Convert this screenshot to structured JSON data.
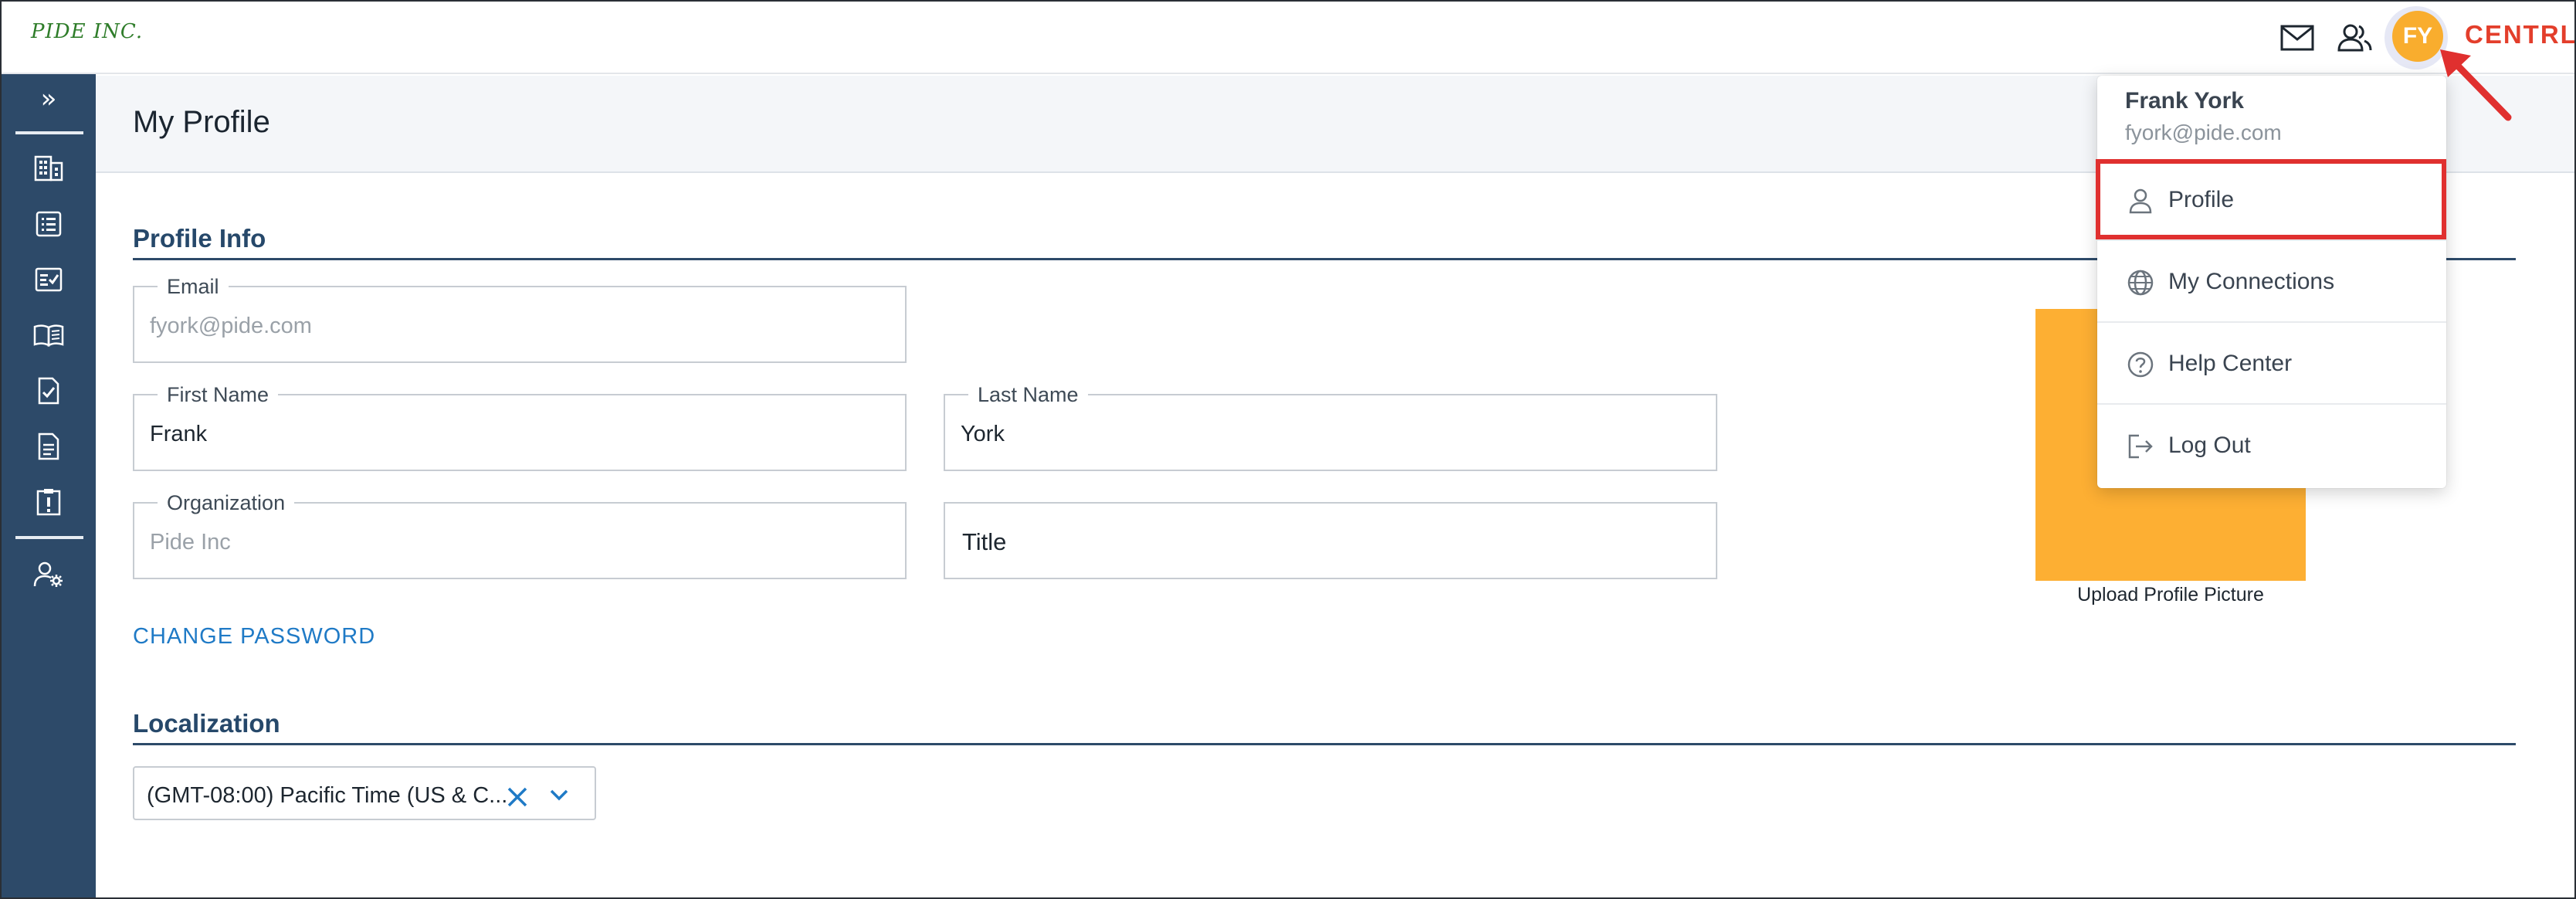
{
  "topbar": {
    "brand": "PIDE INC.",
    "avatar_initials": "FY",
    "product_name": "CENTRL",
    "colors": {
      "avatar": "#f9ad2e",
      "product": "#e33e2b"
    }
  },
  "sidebar": {
    "expand_glyph": "»",
    "items": [
      {
        "icon": "building-icon"
      },
      {
        "icon": "list-icon"
      },
      {
        "icon": "checklist-icon"
      },
      {
        "icon": "book-icon"
      },
      {
        "icon": "file-check-icon"
      },
      {
        "icon": "document-icon"
      },
      {
        "icon": "clipboard-alert-icon"
      },
      {
        "icon": "user-settings-icon"
      }
    ]
  },
  "page": {
    "title": "My Profile"
  },
  "profile_info": {
    "section_title": "Profile Info",
    "email": {
      "label": "Email",
      "value": "fyork@pide.com"
    },
    "first_name": {
      "label": "First Name",
      "value": "Frank"
    },
    "last_name": {
      "label": "Last Name",
      "value": "York"
    },
    "organization": {
      "label": "Organization",
      "value": "Pide Inc"
    },
    "title": {
      "placeholder": "Title"
    },
    "change_password": "CHANGE PASSWORD",
    "upload_caption": "Upload Profile Picture"
  },
  "localization": {
    "section_title": "Localization",
    "timezone": "(GMT-08:00) Pacific Time (US & C..."
  },
  "user_menu": {
    "name": "Frank York",
    "email": "fyork@pide.com",
    "items": [
      {
        "label": "Profile",
        "icon": "person-icon"
      },
      {
        "label": "My Connections",
        "icon": "globe-icon"
      },
      {
        "label": "Help Center",
        "icon": "help-circle-icon"
      },
      {
        "label": "Log Out",
        "icon": "logout-icon"
      }
    ]
  }
}
